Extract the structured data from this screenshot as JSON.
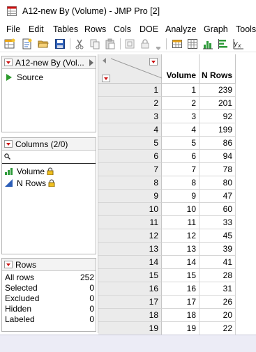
{
  "window": {
    "title": "A12-new By (Volume) - JMP Pro [2]"
  },
  "menu": [
    "File",
    "Edit",
    "Tables",
    "Rows",
    "Cols",
    "DOE",
    "Analyze",
    "Graph",
    "Tools"
  ],
  "toolbar_icons": [
    "new-data-table-icon",
    "new-script-icon",
    "open-folder-icon",
    "save-icon",
    "cut-icon",
    "copy-icon",
    "paste-icon",
    "journal-icon",
    "lock-icon",
    "data-table-list-icon",
    "spreadsheet-icon",
    "histogram-icon",
    "bivariate-icon",
    "fit-model-icon"
  ],
  "table_panel": {
    "title": "A12-new By (Vol...",
    "source_label": "Source"
  },
  "columns_panel": {
    "title": "Columns (2/0)",
    "items": [
      {
        "name": "Volume",
        "icon": "continuous-column-icon",
        "locked": true
      },
      {
        "name": "N Rows",
        "icon": "continuous-column-icon",
        "locked": true
      }
    ]
  },
  "rows_panel": {
    "title": "Rows",
    "items": [
      {
        "label": "All rows",
        "value": "252"
      },
      {
        "label": "Selected",
        "value": "0"
      },
      {
        "label": "Excluded",
        "value": "0"
      },
      {
        "label": "Hidden",
        "value": "0"
      },
      {
        "label": "Labeled",
        "value": "0"
      }
    ]
  },
  "grid": {
    "columns": [
      "Volume",
      "N Rows"
    ],
    "rows": [
      {
        "n": "1",
        "volume": "1",
        "n_rows": "239"
      },
      {
        "n": "2",
        "volume": "2",
        "n_rows": "201"
      },
      {
        "n": "3",
        "volume": "3",
        "n_rows": "92"
      },
      {
        "n": "4",
        "volume": "4",
        "n_rows": "199"
      },
      {
        "n": "5",
        "volume": "5",
        "n_rows": "86"
      },
      {
        "n": "6",
        "volume": "6",
        "n_rows": "94"
      },
      {
        "n": "7",
        "volume": "7",
        "n_rows": "78"
      },
      {
        "n": "8",
        "volume": "8",
        "n_rows": "80"
      },
      {
        "n": "9",
        "volume": "9",
        "n_rows": "47"
      },
      {
        "n": "10",
        "volume": "10",
        "n_rows": "60"
      },
      {
        "n": "11",
        "volume": "11",
        "n_rows": "33"
      },
      {
        "n": "12",
        "volume": "12",
        "n_rows": "45"
      },
      {
        "n": "13",
        "volume": "13",
        "n_rows": "39"
      },
      {
        "n": "14",
        "volume": "14",
        "n_rows": "41"
      },
      {
        "n": "15",
        "volume": "15",
        "n_rows": "28"
      },
      {
        "n": "16",
        "volume": "16",
        "n_rows": "31"
      },
      {
        "n": "17",
        "volume": "17",
        "n_rows": "26"
      },
      {
        "n": "18",
        "volume": "18",
        "n_rows": "20"
      },
      {
        "n": "19",
        "volume": "19",
        "n_rows": "22"
      }
    ]
  },
  "colors": {
    "accent_red": "#cc1111",
    "source_green": "#2c9a2c",
    "rownum_bg": "#ebebeb",
    "status_bg": "#ececf6"
  }
}
